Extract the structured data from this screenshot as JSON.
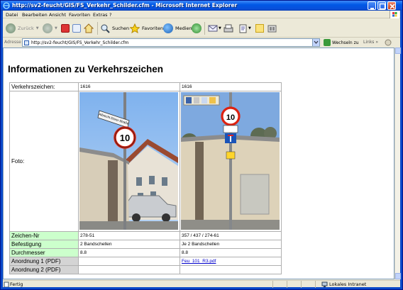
{
  "window": {
    "title": "http://sv2-feucht/GIS/FS_Verkehr_Schilder.cfm - Microsoft Internet Explorer"
  },
  "menu": [
    "Datei",
    "Bearbeiten",
    "Ansicht",
    "Favoriten",
    "Extras",
    "?"
  ],
  "toolbar": {
    "back": "Zurück",
    "search": "Suchen",
    "favorites": "Favoriten",
    "media": "Medien"
  },
  "address": {
    "label": "Adresse",
    "url": "http://sv2-feucht/GIS/FS_Verkehr_Schilder.cfm",
    "go": "Wechseln zu",
    "links": "Links"
  },
  "page": {
    "heading": "Informationen zu Verkehrszeichen"
  },
  "table": {
    "rows": [
      {
        "label": "Verkehrszeichen:",
        "v1": "1616",
        "v2": "1616"
      },
      {
        "label": "Foto:"
      },
      {
        "label": "Zeichen-Nr",
        "v1": "278-51",
        "v2": "357 / 437 / 274-61"
      },
      {
        "label": "Befestigung",
        "v1": "2 Bandschellen",
        "v2": "Je 2 Bandschellen"
      },
      {
        "label": "Durchmesser",
        "v1": "8.8",
        "v2": "8.8"
      },
      {
        "label": "Anordnung 1 (PDF)",
        "v1": "",
        "v2": "Feu_101_R3.pdf"
      },
      {
        "label": "Anordnung 2 (PDF)",
        "v1": "",
        "v2": ""
      }
    ],
    "photo1_sign": "Albrecht Dürer-Straße",
    "photo1_speed": "10",
    "photo2_speed": "10"
  },
  "status": {
    "text": "Fertig",
    "zone": "Lokales Intranet"
  },
  "colors": {
    "label_green": "#ccffcc",
    "label_grey": "#d4d4d4",
    "titlebar": "#0058e6",
    "link": "#0000cc"
  }
}
